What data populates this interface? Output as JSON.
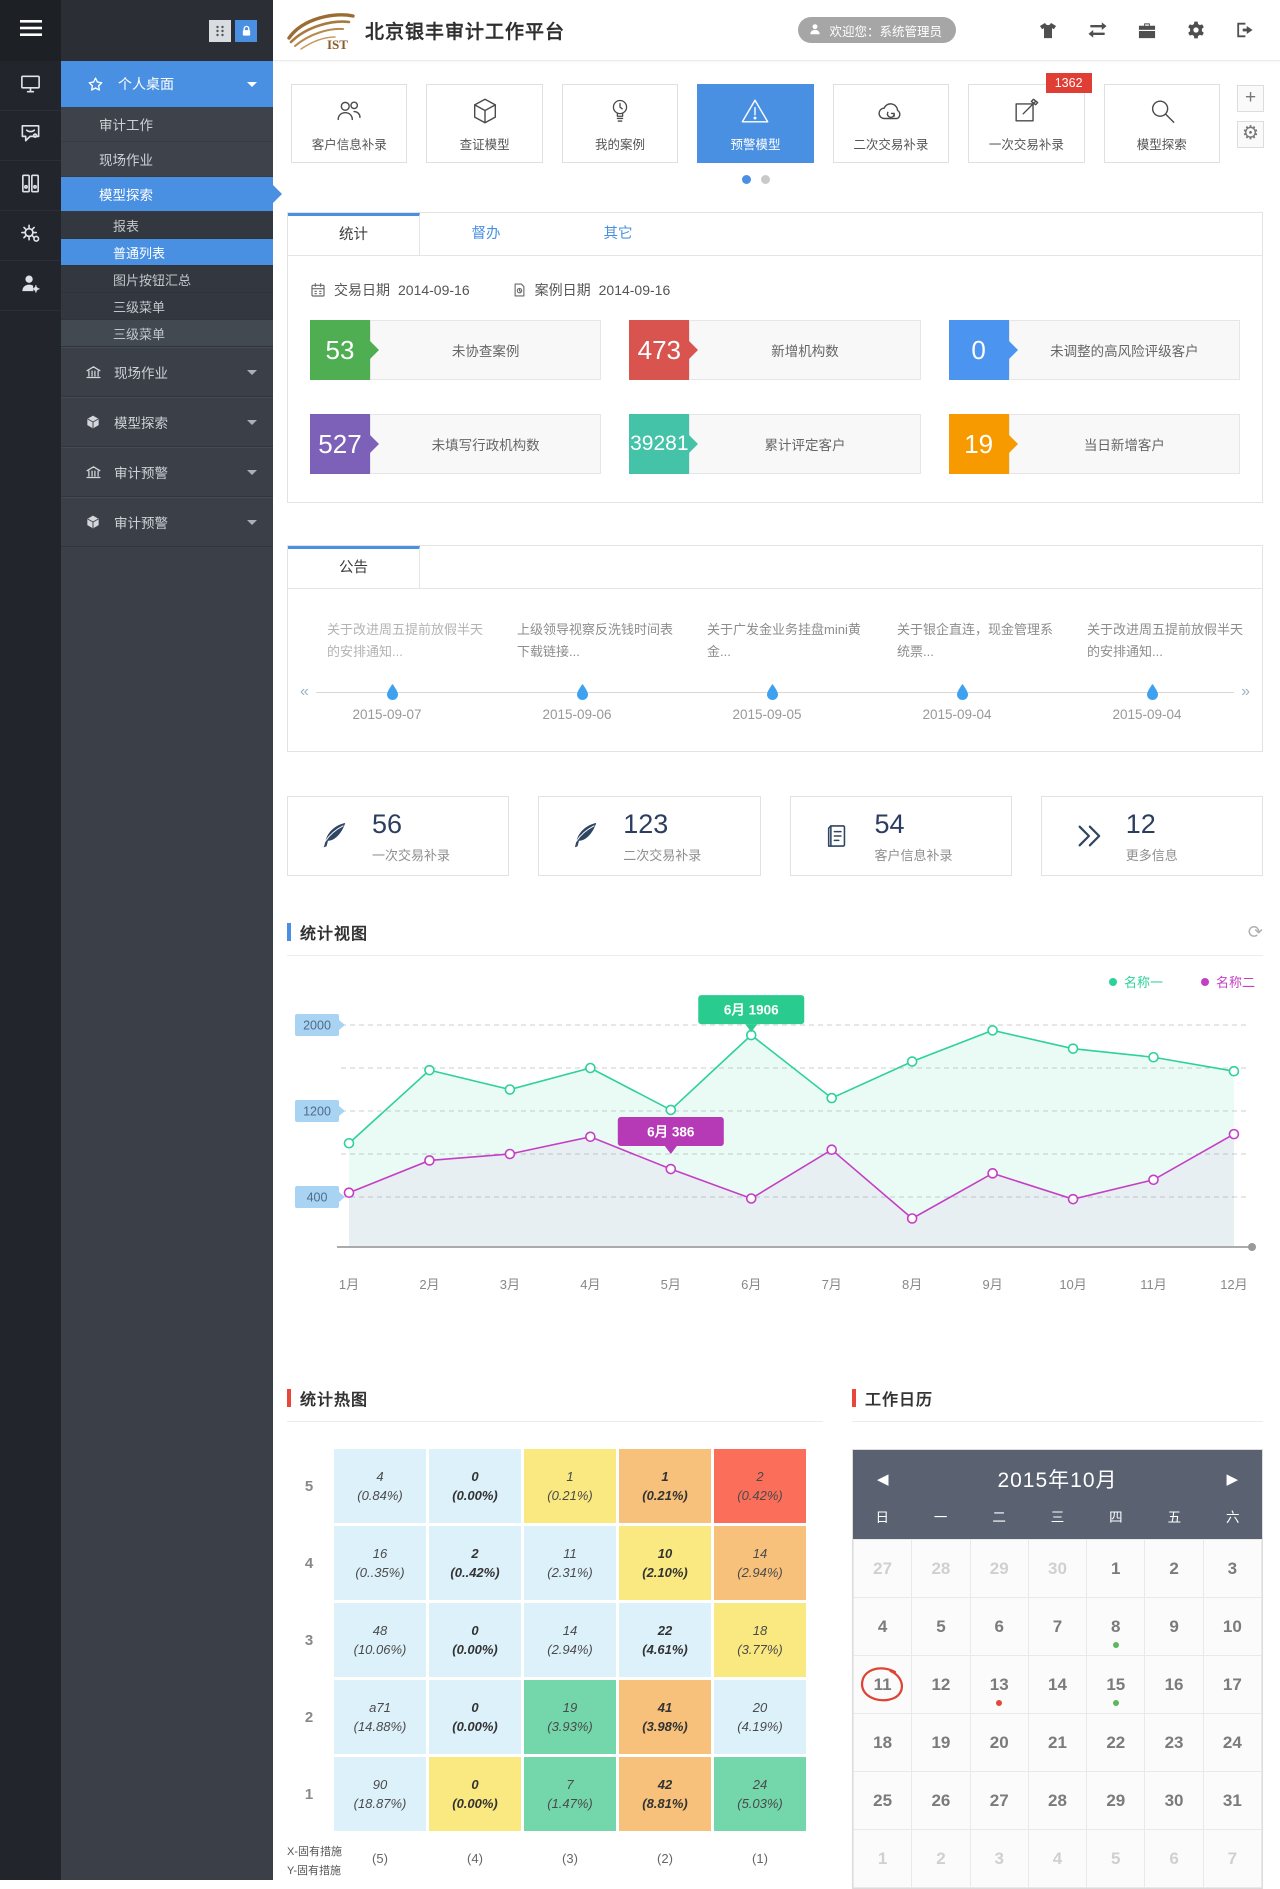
{
  "accent": "#4a90e2",
  "sidebar": {
    "rail_icons": [
      "menu",
      "desktop",
      "message-settings",
      "archive",
      "system-settings",
      "user-admin"
    ],
    "top_buttons": [
      "grid",
      "lock"
    ],
    "menu": [
      {
        "label": "个人桌面"
      },
      {
        "label": "审计工作"
      },
      {
        "label": "现场作业"
      },
      {
        "label": "模型探索"
      },
      {
        "label": "报表"
      },
      {
        "label": "普通列表"
      },
      {
        "label": "图片按钮汇总"
      },
      {
        "label": "三级菜单"
      },
      {
        "label": "三级菜单"
      }
    ],
    "groups": [
      {
        "label": "现场作业",
        "icon": "bank"
      },
      {
        "label": "模型探索",
        "icon": "cube"
      },
      {
        "label": "审计预警",
        "icon": "bank"
      },
      {
        "label": "审计预警",
        "icon": "cube"
      }
    ]
  },
  "header": {
    "logo_text": "IST",
    "title": "北京银丰审计工作平台",
    "welcome": "欢迎您：系统管理员",
    "icon_names": [
      "comment",
      "tshirt",
      "swap-arrows",
      "briefcase",
      "gear",
      "logout"
    ]
  },
  "toolbar": {
    "items": [
      {
        "label": "客户信息补录",
        "icon": "users"
      },
      {
        "label": "查证模型",
        "icon": "box"
      },
      {
        "label": "我的案例",
        "icon": "bulb"
      },
      {
        "label": "预警模型",
        "icon": "warning",
        "active": true
      },
      {
        "label": "二次交易补录",
        "icon": "cloud-sync"
      },
      {
        "label": "一次交易补录",
        "icon": "edit",
        "badge": "1362"
      },
      {
        "label": "模型探索",
        "icon": "search"
      }
    ],
    "add_label": "+",
    "settings_glyph": "⚙",
    "pager_dots": 2,
    "pager_active_index": 0
  },
  "tabs": {
    "items": [
      "统计",
      "督办",
      "其它"
    ],
    "active": "统计"
  },
  "stats": {
    "dates": [
      {
        "icon": "calendar",
        "label": "交易日期",
        "value": "2014-09-16"
      },
      {
        "icon": "doc",
        "label": "案例日期",
        "value": "2014-09-16"
      }
    ],
    "cards": [
      {
        "value": "53",
        "label": "未协查案例",
        "color_key": "green",
        "color": "#4fae52"
      },
      {
        "value": "473",
        "label": "新增机构数",
        "color_key": "red",
        "color": "#d9534f"
      },
      {
        "value": "0",
        "label": "未调整的高风险评级客户",
        "color_key": "blue",
        "color": "#4b94ef"
      },
      {
        "value": "527",
        "label": "未填写行政机构数",
        "color_key": "purple",
        "color": "#7d60b8"
      },
      {
        "value": "39281",
        "label": "累计评定客户",
        "color_key": "teal",
        "color": "#45c3a8"
      },
      {
        "value": "19",
        "label": "当日新增客户",
        "color_key": "orange",
        "color": "#f79a00"
      }
    ]
  },
  "announcements": {
    "tab": "公告",
    "prev_glyph": "«",
    "next_glyph": "»",
    "items": [
      {
        "text": "关于改进周五提前放假半天的安排通知...",
        "date": "2015-09-07",
        "muted": true
      },
      {
        "text": "上级领导视察反洗钱时间表下载链接...",
        "date": "2015-09-06",
        "muted": false
      },
      {
        "text": "关于广发金业务挂盘mini黄金...",
        "date": "2015-09-05",
        "muted": false
      },
      {
        "text": "关于银企直连，现金管理系统票...",
        "date": "2015-09-04",
        "muted": false
      },
      {
        "text": "关于改进周五提前放假半天的安排通知...",
        "date": "2015-09-04",
        "muted": false
      }
    ]
  },
  "summary_cards": [
    {
      "icon": "quill",
      "value": "56",
      "label": "一次交易补录"
    },
    {
      "icon": "quill",
      "value": "123",
      "label": "二次交易补录"
    },
    {
      "icon": "doc-lines",
      "value": "54",
      "label": "客户信息补录"
    },
    {
      "icon": "chevrons-right",
      "value": "12",
      "label": "更多信息"
    }
  ],
  "chart_section": {
    "title": "统计视图",
    "refresh_glyph": "⟳"
  },
  "chart_data": {
    "type": "line",
    "title": "统计视图",
    "categories": [
      "1月",
      "2月",
      "3月",
      "4月",
      "5月",
      "6月",
      "7月",
      "8月",
      "9月",
      "10月",
      "11月",
      "12月"
    ],
    "series": [
      {
        "name": "名称一",
        "color": "#2ed19c",
        "values": [
          900,
          1580,
          1400,
          1600,
          1210,
          1906,
          1320,
          1660,
          1950,
          1780,
          1700,
          1570
        ]
      },
      {
        "name": "名称二",
        "color": "#c43fc4",
        "values": [
          440,
          740,
          800,
          960,
          660,
          386,
          840,
          200,
          620,
          380,
          560,
          985
        ]
      }
    ],
    "gridlines": [
      2000,
      1600,
      1200,
      800,
      400
    ],
    "ytick_labels": [
      2000,
      1200,
      400
    ],
    "ylim": [
      0,
      2133
    ],
    "grid": true,
    "legend_position": "top-right",
    "tooltips": [
      {
        "series": 0,
        "anchor_index": 5,
        "label": "6月 1906"
      },
      {
        "series": 1,
        "anchor_index": 4,
        "label": "6月 386"
      }
    ]
  },
  "heatmap": {
    "title": "统计热图",
    "row_labels": [
      "5",
      "4",
      "3",
      "2",
      "1"
    ],
    "col_labels": [
      "(5)",
      "(4)",
      "(3)",
      "(2)",
      "(1)"
    ],
    "axis_caption_x": "X-固有措施",
    "axis_caption_y": "Y-固有措施",
    "palette": {
      "blue": "#ddf1fa",
      "yellow": "#fae981",
      "orange": "#f7c17b",
      "red": "#fa6e5a",
      "green": "#74d6ab"
    },
    "rows": [
      [
        {
          "v": "4",
          "p": "(0.84%)",
          "c": "blue"
        },
        {
          "v": "0",
          "p": "(0.00%)",
          "c": "blue",
          "b": true
        },
        {
          "v": "1",
          "p": "(0.21%)",
          "c": "yellow"
        },
        {
          "v": "1",
          "p": "(0.21%)",
          "c": "orange",
          "b": true
        },
        {
          "v": "2",
          "p": "(0.42%)",
          "c": "red"
        }
      ],
      [
        {
          "v": "16",
          "p": "(0..35%)",
          "c": "blue"
        },
        {
          "v": "2",
          "p": "(0..42%)",
          "c": "blue",
          "b": true
        },
        {
          "v": "11",
          "p": "(2.31%)",
          "c": "blue"
        },
        {
          "v": "10",
          "p": "(2.10%)",
          "c": "yellow",
          "b": true
        },
        {
          "v": "14",
          "p": "(2.94%)",
          "c": "orange"
        }
      ],
      [
        {
          "v": "48",
          "p": "(10.06%)",
          "c": "blue"
        },
        {
          "v": "0",
          "p": "(0.00%)",
          "c": "blue",
          "b": true
        },
        {
          "v": "14",
          "p": "(2.94%)",
          "c": "blue"
        },
        {
          "v": "22",
          "p": "(4.61%)",
          "c": "blue",
          "b": true
        },
        {
          "v": "18",
          "p": "(3.77%)",
          "c": "yellow"
        }
      ],
      [
        {
          "v": "a71",
          "p": "(14.88%)",
          "c": "blue"
        },
        {
          "v": "0",
          "p": "(0.00%)",
          "c": "blue",
          "b": true
        },
        {
          "v": "19",
          "p": "(3.93%)",
          "c": "green"
        },
        {
          "v": "41",
          "p": "(3.98%)",
          "c": "orange",
          "b": true
        },
        {
          "v": "20",
          "p": "(4.19%)",
          "c": "blue"
        }
      ],
      [
        {
          "v": "90",
          "p": "(18.87%)",
          "c": "blue"
        },
        {
          "v": "0",
          "p": "(0.00%)",
          "c": "yellow",
          "b": true
        },
        {
          "v": "7",
          "p": "(1.47%)",
          "c": "green"
        },
        {
          "v": "42",
          "p": "(8.81%)",
          "c": "orange",
          "b": true
        },
        {
          "v": "24",
          "p": "(5.03%)",
          "c": "green"
        }
      ]
    ]
  },
  "calendar": {
    "title": "工作日历",
    "month_label": "2015年10月",
    "prev_glyph": "◀",
    "next_glyph": "▶",
    "weekdays": [
      "日",
      "一",
      "二",
      "三",
      "四",
      "五",
      "六"
    ],
    "dot_colors": {
      "green": "#5cb85c",
      "red": "#e4473a"
    },
    "weeks": [
      [
        {
          "d": "27",
          "muted": true
        },
        {
          "d": "28",
          "muted": true
        },
        {
          "d": "29",
          "muted": true
        },
        {
          "d": "30",
          "muted": true
        },
        {
          "d": "1"
        },
        {
          "d": "2"
        },
        {
          "d": "3"
        }
      ],
      [
        {
          "d": "4"
        },
        {
          "d": "5"
        },
        {
          "d": "6"
        },
        {
          "d": "7"
        },
        {
          "d": "8",
          "dot": "green"
        },
        {
          "d": "9"
        },
        {
          "d": "10"
        }
      ],
      [
        {
          "d": "11",
          "circled": true
        },
        {
          "d": "12"
        },
        {
          "d": "13",
          "dot": "red"
        },
        {
          "d": "14"
        },
        {
          "d": "15",
          "dot": "green"
        },
        {
          "d": "16"
        },
        {
          "d": "17"
        }
      ],
      [
        {
          "d": "18"
        },
        {
          "d": "19"
        },
        {
          "d": "20"
        },
        {
          "d": "21"
        },
        {
          "d": "22"
        },
        {
          "d": "23"
        },
        {
          "d": "24"
        }
      ],
      [
        {
          "d": "25"
        },
        {
          "d": "26"
        },
        {
          "d": "27"
        },
        {
          "d": "28"
        },
        {
          "d": "29"
        },
        {
          "d": "30"
        },
        {
          "d": "31"
        }
      ],
      [
        {
          "d": "1",
          "muted": true
        },
        {
          "d": "2",
          "muted": true
        },
        {
          "d": "3",
          "muted": true
        },
        {
          "d": "4",
          "muted": true
        },
        {
          "d": "5",
          "muted": true
        },
        {
          "d": "6",
          "muted": true
        },
        {
          "d": "7",
          "muted": true
        }
      ]
    ]
  }
}
